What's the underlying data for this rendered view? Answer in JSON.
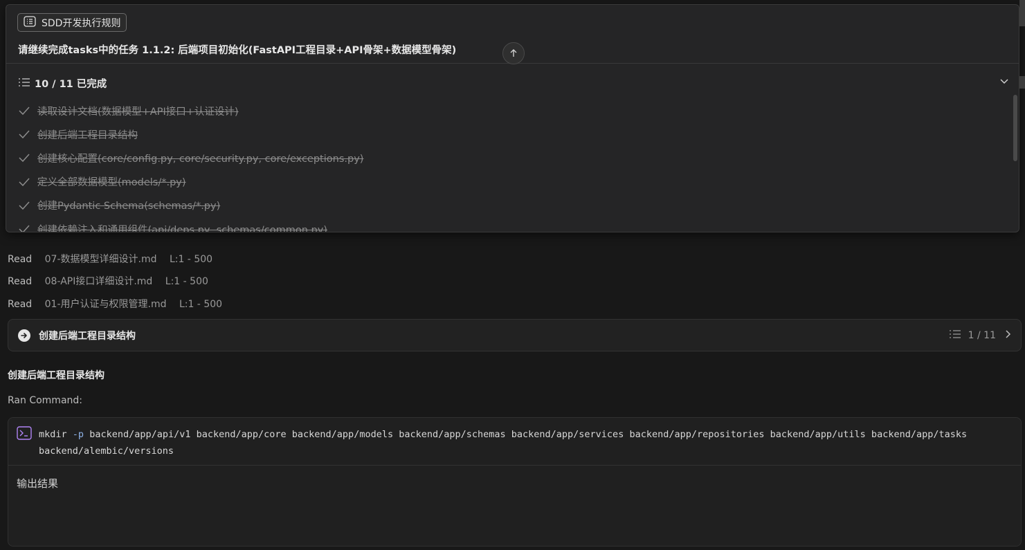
{
  "log": {
    "reads": [
      {
        "verb": "Read",
        "file": "07-数据模型详细设计.md",
        "range": "L:1 - 500"
      },
      {
        "verb": "Read",
        "file": "08-API接口详细设计.md",
        "range": "L:1 - 500"
      },
      {
        "verb": "Read",
        "file": "01-用户认证与权限管理.md",
        "range": "L:1 - 500"
      }
    ],
    "step_card": {
      "title": "创建后端工程目录结构",
      "count": "1 / 11"
    },
    "heading": "创建后端工程目录结构",
    "ran_label": "Ran Command:",
    "command": {
      "cmd": "mkdir",
      "flag": "-p",
      "args": "backend/app/api/v1 backend/app/core backend/app/models backend/app/schemas backend/app/services backend/app/repositories backend/app/utils backend/app/tasks backend/alembic/versions"
    },
    "output_label": "输出结果"
  },
  "overlay": {
    "rule_chip": "SDD开发执行规则",
    "prompt": "请继续完成tasks中的任务 1.1.2: 后端项目初始化(FastAPI工程目录+API骨架+数据模型骨架)",
    "todo_header": "10 / 11 已完成",
    "todos": [
      {
        "label": "读取设计文档(数据模型+API接口+认证设计)"
      },
      {
        "label": "创建后端工程目录结构"
      },
      {
        "label": "创建核心配置(core/config.py, core/security.py, core/exceptions.py)"
      },
      {
        "label": "定义全部数据模型(models/*.py)"
      },
      {
        "label": "创建Pydantic Schema(schemas/*.py)"
      },
      {
        "label": "创建依赖注入和通用组件(api/deps.py, schemas/common.py)"
      }
    ]
  },
  "colors": {
    "background": "#181818",
    "panel": "#252526",
    "accent_terminal": "#b084f5",
    "flag": "#8fb3e8"
  },
  "icons": [
    "rules-icon",
    "scroll-up-icon",
    "list-icon",
    "chevron-down-icon",
    "check-icon",
    "arrow-right-circle-icon",
    "chevron-right-icon",
    "terminal-icon"
  ]
}
